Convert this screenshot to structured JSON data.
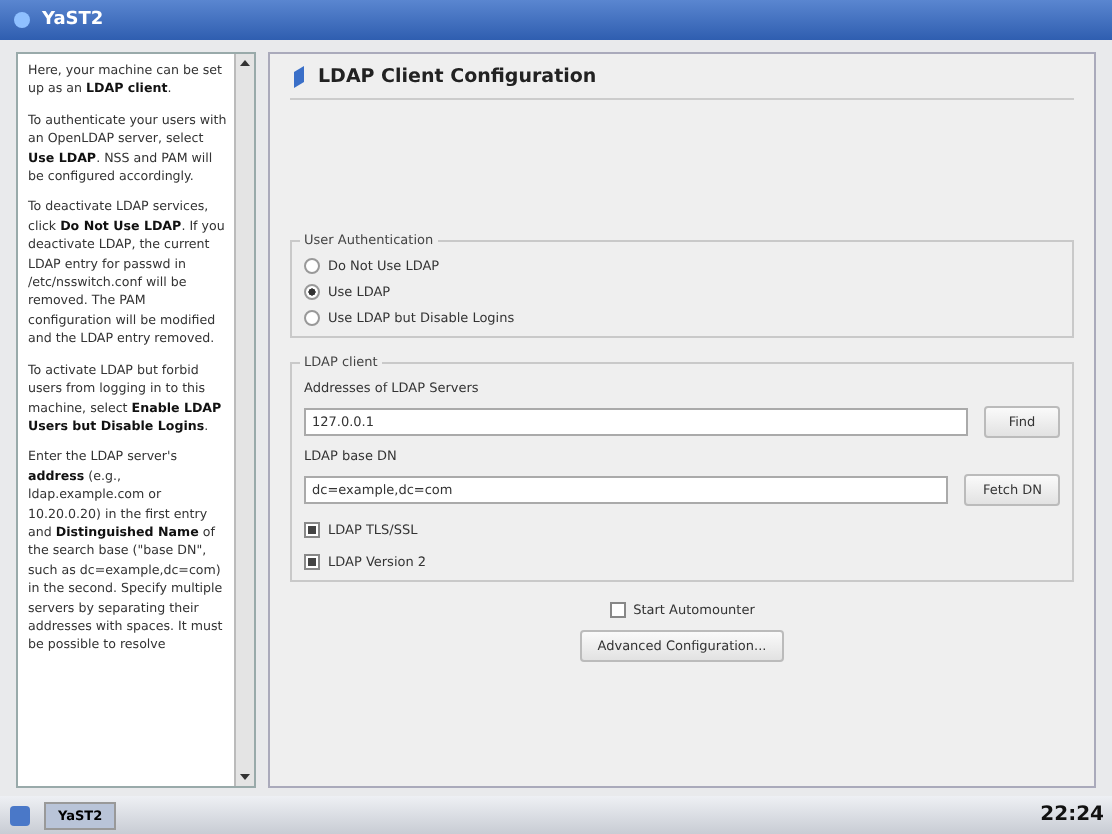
{
  "window": {
    "title": "YaST2"
  },
  "help": {
    "paragraphs": [
      "Here, your machine can be set up as an **LDAP client**.",
      "To authenticate your users with an OpenLDAP server, select **Use LDAP**. NSS and PAM will be configured accordingly.",
      "To deactivate LDAP services, click **Do Not Use LDAP**. If you deactivate LDAP, the current LDAP entry for passwd in /etc/nsswitch.conf will be removed. The PAM configuration will be modified and the LDAP entry removed.",
      "To activate LDAP but forbid users from logging in to this machine, select **Enable LDAP Users but Disable Logins**.",
      "Enter the LDAP server's **address** (e.g., ldap.example.com or 10.20.0.20) in the first entry and **Distinguished Name** of the search base (\"base DN\", such as dc=example,dc=com) in the second. Specify multiple servers by separating their addresses with spaces. It must be possible to resolve"
    ]
  },
  "header": {
    "title": "LDAP Client Configuration"
  },
  "user_authentication": {
    "title": "User Authentication",
    "options": [
      {
        "label": "Do Not Use LDAP",
        "selected": false
      },
      {
        "label": "Use LDAP",
        "selected": true
      },
      {
        "label": "Use LDAP but Disable Logins",
        "selected": false
      }
    ]
  },
  "ldap_client": {
    "title": "LDAP client",
    "servers": {
      "label": "Addresses of LDAP Servers",
      "value": "127.0.0.1",
      "button": "Find"
    },
    "base_dn": {
      "label": "LDAP base DN",
      "value": "dc=example,dc=com",
      "button": "Fetch DN"
    },
    "checkboxes": [
      {
        "label": "LDAP TLS/SSL",
        "checked": true
      },
      {
        "label": "LDAP Version 2",
        "checked": true
      }
    ]
  },
  "automounter": {
    "label": "Start Automounter",
    "checked": false
  },
  "advanced_button": "Advanced Configuration...",
  "taskbar": {
    "tasks": [
      {
        "label": "YaST2",
        "selected": true
      }
    ],
    "clock": "22:24"
  }
}
